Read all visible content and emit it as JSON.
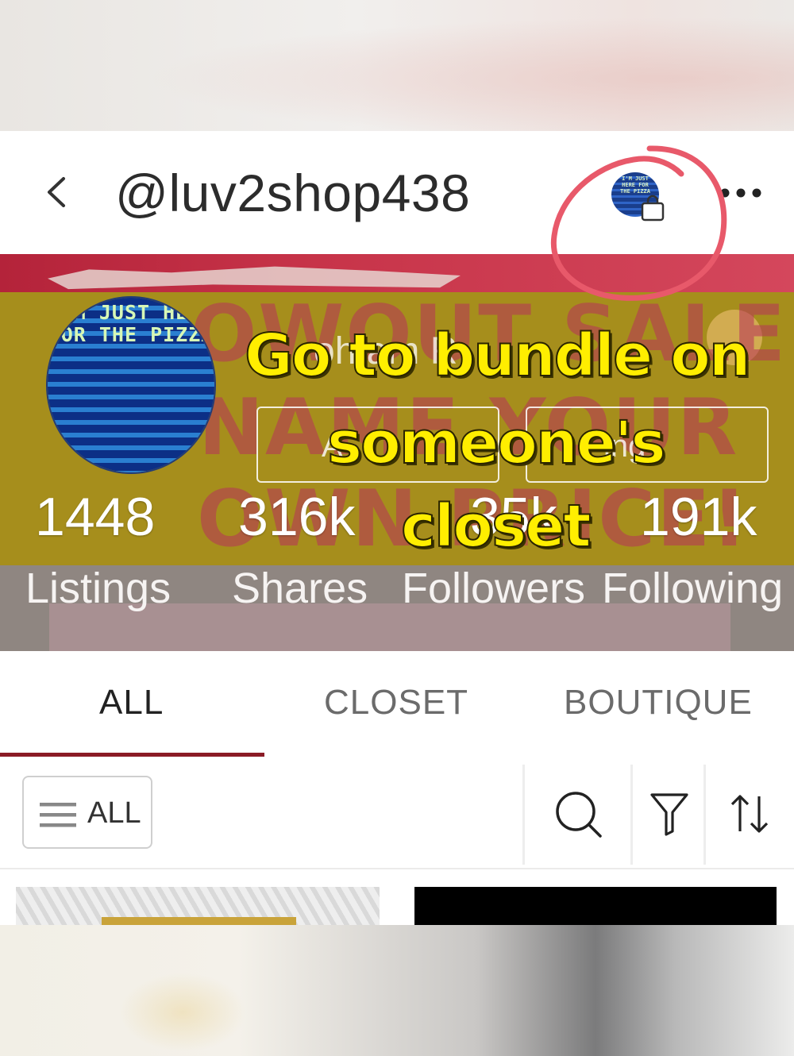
{
  "header": {
    "back_icon": "chevron-left-icon",
    "username": "@luv2shop438",
    "bundle_icon": "shopping-bag-icon",
    "more_icon": "more-horizontal-icon",
    "avatar_text": "I'M JUST HERE FOR THE PIZZA"
  },
  "cover": {
    "avatar_text": "I'M JUST HERE FOR THE PIZZA",
    "background_lines": [
      "OWOUT SALE!",
      "NAME YOUR",
      "OWN PRICE!"
    ],
    "faded_name": "oh am  R",
    "pill_left": "A",
    "pill_right": "ing"
  },
  "stats": [
    {
      "value": "1448",
      "label": "Listings"
    },
    {
      "value": "316k",
      "label": "Shares"
    },
    {
      "value": "35k",
      "label": "Followers"
    },
    {
      "value": "191k",
      "label": "Following"
    }
  ],
  "annotation": {
    "lines": [
      "Go to bundle on",
      "someone's",
      "closet"
    ],
    "text_color": "#ffee00",
    "circle_color": "#e8596a"
  },
  "tabs": [
    {
      "label": "ALL",
      "active": true
    },
    {
      "label": "CLOSET",
      "active": false
    },
    {
      "label": "BOUTIQUE",
      "active": false
    }
  ],
  "toolbar": {
    "filter_label": "ALL",
    "filter_icon": "menu-icon",
    "search_icon": "search-icon",
    "funnel_icon": "filter-icon",
    "sort_icon": "sort-icon"
  },
  "colors": {
    "accent": "#8b1b26",
    "cover_gold": "#a68e1c"
  }
}
